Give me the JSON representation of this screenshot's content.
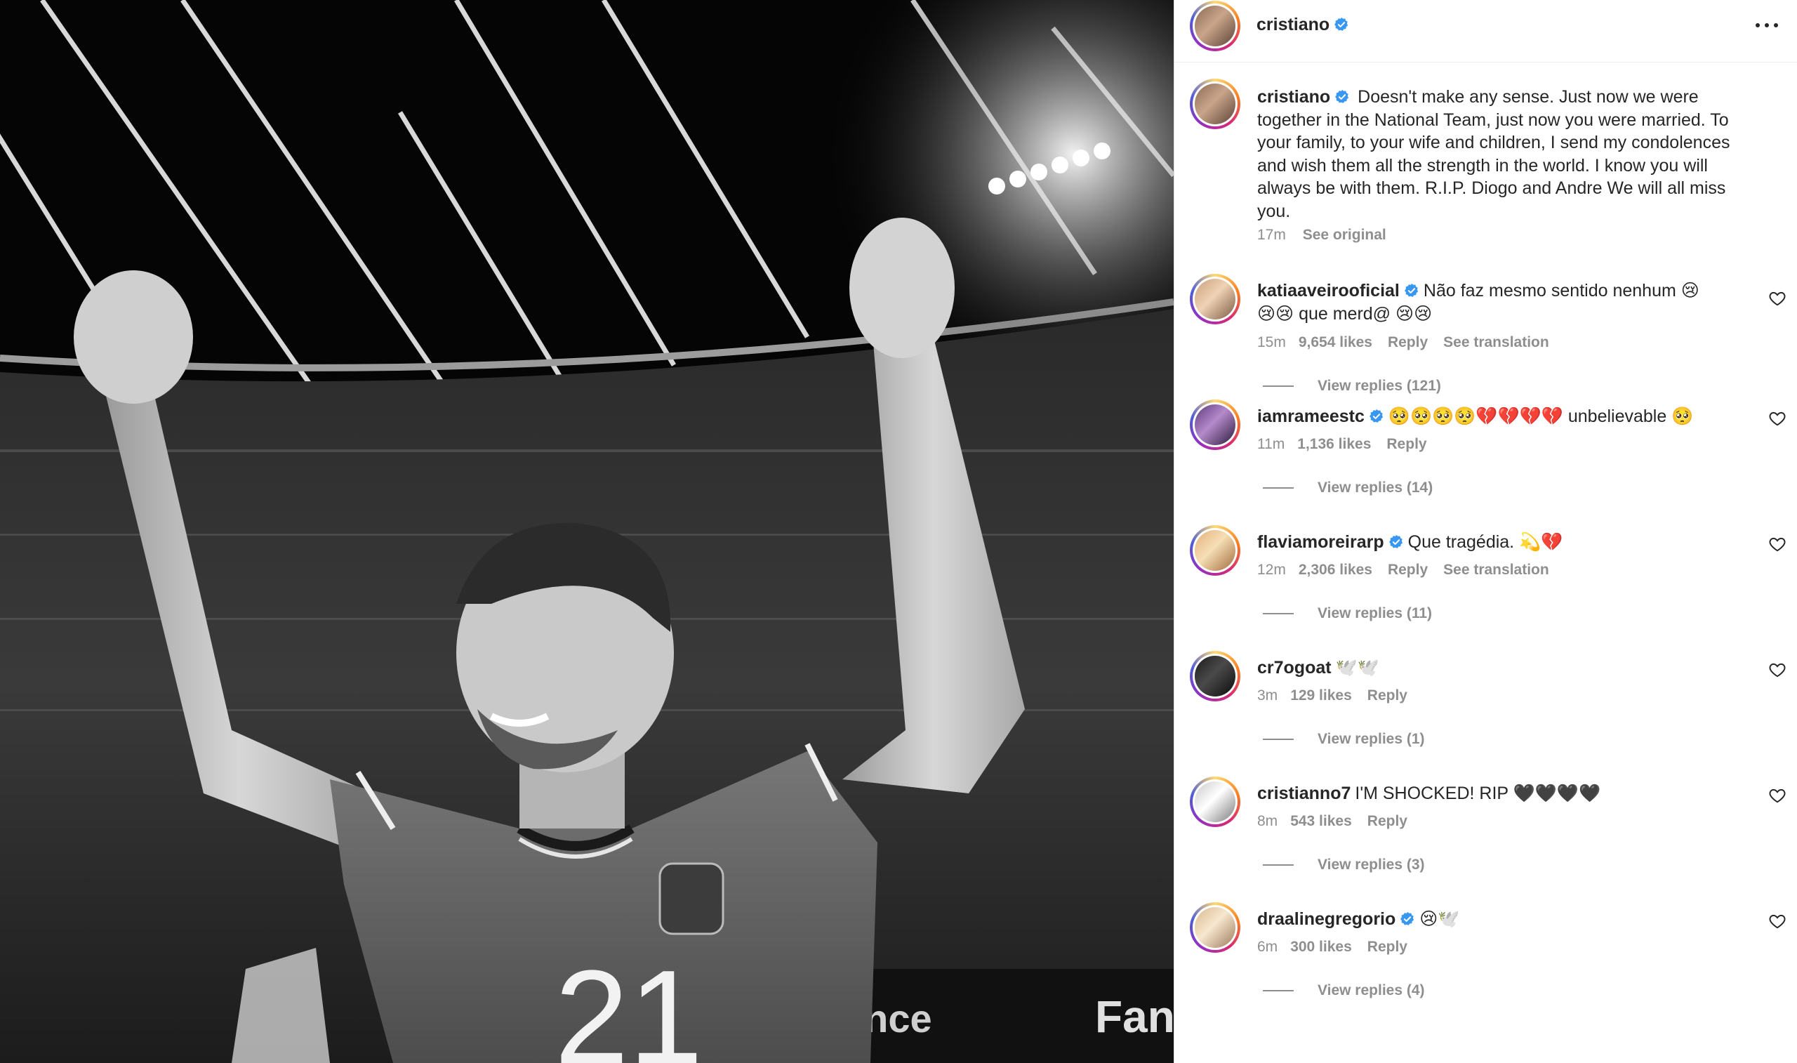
{
  "post": {
    "author": "cristiano",
    "more_icon": "more-horizontal-icon",
    "caption": {
      "username": "cristiano",
      "text": "Doesn't make any sense. Just now we were together in the National Team, just now you were married. To your family, to your wife and children, I send my condolences and wish them all the strength in the world. I know you will always be with them. R.I.P. Diogo and Andre We will all miss you.",
      "time": "17m",
      "see_original": "See original"
    }
  },
  "photo": {
    "jersey_number": "21",
    "board_text": "ence",
    "board_text_2": "Fan"
  },
  "comments": [
    {
      "username": "katiaaveirooficial",
      "verified": true,
      "text": "Não faz mesmo sentido nenhum 😢😢😢 que merd@ 😢😢",
      "time": "15m",
      "likes": "9,654 likes",
      "reply": "Reply",
      "translation": "See translation",
      "view_replies": "View replies (121)"
    },
    {
      "username": "iamrameestc",
      "verified": true,
      "text": "🥺🥺🥺🥺💔💔💔💔 unbelievable 🥺",
      "time": "11m",
      "likes": "1,136 likes",
      "reply": "Reply",
      "translation": "",
      "view_replies": "View replies (14)"
    },
    {
      "username": "flaviamoreirarp",
      "verified": true,
      "text": "Que tragédia. 💫💔",
      "time": "12m",
      "likes": "2,306 likes",
      "reply": "Reply",
      "translation": "See translation",
      "view_replies": "View replies (11)"
    },
    {
      "username": "cr7ogoat",
      "verified": false,
      "text": "🕊️🕊️",
      "time": "3m",
      "likes": "129 likes",
      "reply": "Reply",
      "translation": "",
      "view_replies": "View replies (1)"
    },
    {
      "username": "cristianno7",
      "verified": false,
      "text": "I'M SHOCKED! RIP 🖤🖤🖤🖤",
      "time": "8m",
      "likes": "543 likes",
      "reply": "Reply",
      "translation": "",
      "view_replies": "View replies (3)"
    },
    {
      "username": "draalinegregorio",
      "verified": true,
      "text": "😢🕊️",
      "time": "6m",
      "likes": "300 likes",
      "reply": "Reply",
      "translation": "",
      "view_replies": "View replies (4)"
    }
  ],
  "colors": {
    "verified_blue": "#3897f0",
    "muted_text": "#8e8e8e",
    "text": "#262626",
    "divider": "#efefef"
  }
}
